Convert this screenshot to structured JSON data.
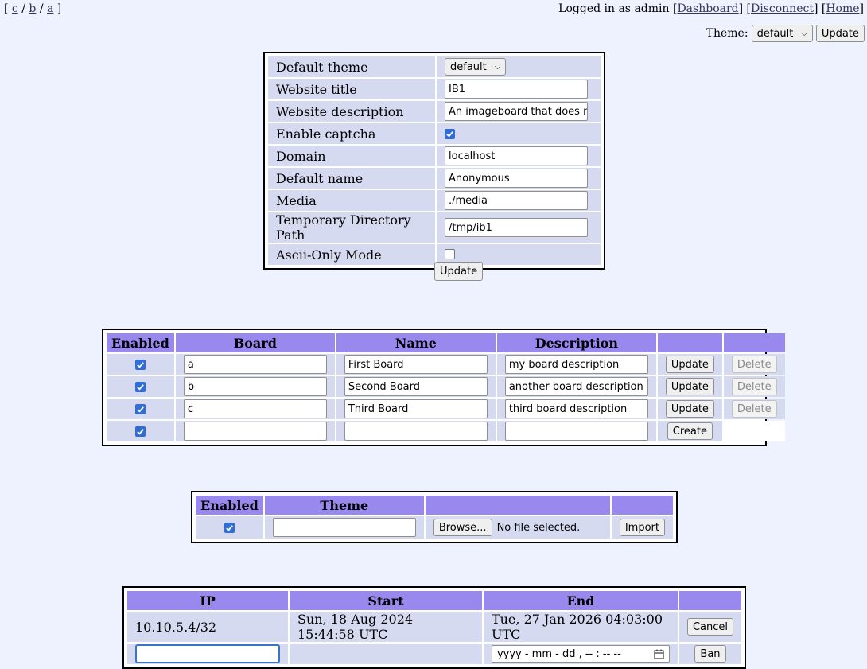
{
  "boardnav": {
    "open": "[",
    "close": "]",
    "sep": "/",
    "links": [
      "c",
      "b",
      "a"
    ]
  },
  "userbar": {
    "prefix": "Logged in as admin",
    "links": [
      "Dashboard",
      "Disconnect",
      "Home"
    ]
  },
  "themebar": {
    "label": "Theme:",
    "selected": "default",
    "update_label": "Update"
  },
  "settings": {
    "rows": [
      {
        "label": "Default theme",
        "value": "default",
        "kind": "select"
      },
      {
        "label": "Website title",
        "value": "IB1",
        "kind": "text"
      },
      {
        "label": "Website description",
        "value": "An imageboard that does n",
        "kind": "text"
      },
      {
        "label": "Enable captcha",
        "checked": true,
        "kind": "checkbox"
      },
      {
        "label": "Domain",
        "value": "localhost",
        "kind": "text"
      },
      {
        "label": "Default name",
        "value": "Anonymous",
        "kind": "text"
      },
      {
        "label": "Media",
        "value": "./media",
        "kind": "text"
      },
      {
        "label": "Temporary Directory Path",
        "value": "/tmp/ib1",
        "kind": "text"
      },
      {
        "label": "Ascii-Only Mode",
        "checked": false,
        "kind": "checkbox"
      }
    ],
    "update_label": "Update"
  },
  "boards": {
    "headers": [
      "Enabled",
      "Board",
      "Name",
      "Description",
      "",
      ""
    ],
    "rows": [
      {
        "enabled": true,
        "board": "a",
        "name": "First Board",
        "description": "my board description",
        "update": "Update",
        "delete": "Delete"
      },
      {
        "enabled": true,
        "board": "b",
        "name": "Second Board",
        "description": "another board description",
        "update": "Update",
        "delete": "Delete"
      },
      {
        "enabled": true,
        "board": "c",
        "name": "Third Board",
        "description": "third board description",
        "update": "Update",
        "delete": "Delete"
      }
    ],
    "new_row": {
      "enabled": true,
      "board": "",
      "name": "",
      "description": "",
      "create": "Create"
    }
  },
  "themes": {
    "headers": [
      "Enabled",
      "Theme",
      "",
      ""
    ],
    "row": {
      "enabled": true,
      "theme": "",
      "browse": "Browse...",
      "file_status": "No file selected.",
      "import": "Import"
    }
  },
  "bans": {
    "headers": [
      "IP",
      "Start",
      "End",
      ""
    ],
    "rows": [
      {
        "ip": "10.10.5.4/32",
        "start": "Sun, 18 Aug 2024 15:44:58 UTC",
        "end": "Tue, 27 Jan 2026 04:03:00 UTC",
        "action": "Cancel"
      }
    ],
    "new_row": {
      "ip": "",
      "end_placeholder": "yyyy - mm - dd ,  -- : --  --",
      "action": "Ban"
    }
  },
  "colors": {
    "header_bg": "#9988ee",
    "cell_bg": "#d6daf0",
    "page_bg": "#eef2ff",
    "link": "#34345c",
    "checkbox": "#2f6ed6"
  }
}
